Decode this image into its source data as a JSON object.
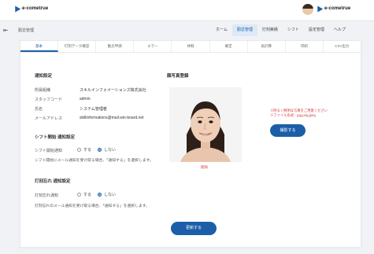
{
  "brand": {
    "name": "e-cometrue"
  },
  "breadcrumb": "勤怠管理",
  "nav": [
    {
      "label": "ホーム",
      "active": false
    },
    {
      "label": "勤怠管理",
      "active": true
    },
    {
      "label": "打刻実績",
      "active": false
    },
    {
      "label": "シフト",
      "active": false
    },
    {
      "label": "設定管理",
      "active": false
    },
    {
      "label": "ヘルプ",
      "active": false
    }
  ],
  "tabs": [
    "基本",
    "打刻データ確認",
    "勤怠申請",
    "エラー",
    "休暇",
    "確定",
    "再計算",
    "印刷",
    "CSV出力"
  ],
  "notification": {
    "title": "通知設定",
    "rows": [
      {
        "label": "所属組織",
        "value": "スキルインフォメーションズ株式会社"
      },
      {
        "label": "スタッフコード",
        "value": "admin"
      },
      {
        "label": "氏名",
        "value": "システム管理者"
      },
      {
        "label": "メールアドレス",
        "value": "skillinformations@mail.win-board.net"
      }
    ]
  },
  "shift_start": {
    "title": "シフト開始 通知設定",
    "label": "シフト開始通知",
    "option_yes": "する",
    "option_no": "しない",
    "selected": "しない",
    "note": "シフト開始にメール通知を受け取る場合、「通知する」を選択します。"
  },
  "clock_forget": {
    "title": "打刻忘れ 通知設定",
    "label": "打刻忘れ通知",
    "option_yes": "する",
    "option_no": "しない",
    "selected": "しない",
    "note": "打刻忘れのメール通知を受け取る場合、「通知する」を選択します。"
  },
  "photo": {
    "title": "顔写真登録",
    "delete_label": "削除",
    "warning_line1": "※明るく鮮明な写真をご用意ください",
    "warning_line2": "※ファイル形式：jpg,png,jpeg",
    "shoot_button": "撮影する"
  },
  "update_button": "更新する",
  "colors": {
    "accent": "#1c5fa8",
    "danger": "#d23b3b",
    "active_nav_bg": "#dde9f6"
  }
}
